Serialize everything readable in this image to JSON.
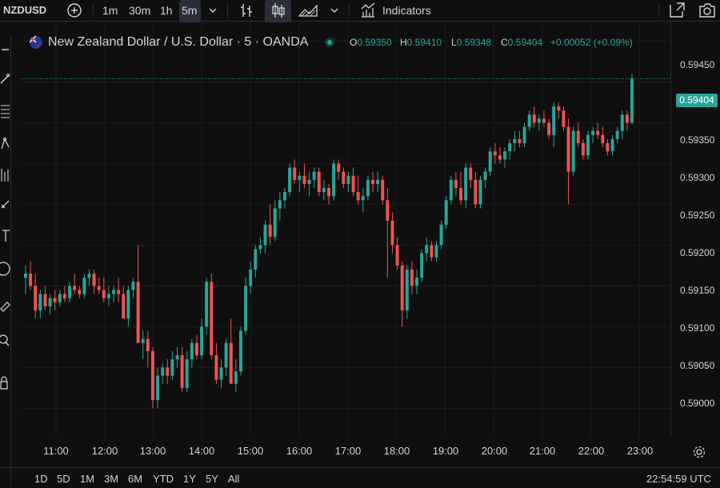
{
  "toolbar": {
    "symbol": "NZDUSD",
    "intervals": [
      "1m",
      "30m",
      "1h",
      "5m"
    ],
    "active_interval": "5m",
    "indicators_label": "Indicators"
  },
  "legend": {
    "title": "New Zealand Dollar / U.S. Dollar · 5 · OANDA",
    "o_key": "O",
    "o_val": "0.59350",
    "h_key": "H",
    "h_val": "0.59410",
    "l_key": "L",
    "l_val": "0.59348",
    "c_key": "C",
    "c_val": "0.59404",
    "change": "+0.00052 (+0.09%)"
  },
  "current_price": "0.59404",
  "colors": {
    "up": "#26a69a",
    "down": "#ef5350",
    "background": "#0f0f0f",
    "grid": "#1c1c1c"
  },
  "bottom": {
    "ranges": [
      "1D",
      "5D",
      "1M",
      "3M",
      "6M",
      "YTD",
      "1Y",
      "5Y",
      "All"
    ],
    "clock": "22:54:59 UTC"
  },
  "chart_data": {
    "type": "candlestick",
    "title": "New Zealand Dollar / U.S. Dollar · 5 · OANDA",
    "y_ticks": [
      "0.59450",
      "0.59400",
      "0.59350",
      "0.59300",
      "0.59250",
      "0.59200",
      "0.59150",
      "0.59100",
      "0.59050",
      "0.59000"
    ],
    "x_ticks": [
      "11:00",
      "12:00",
      "13:00",
      "14:00",
      "15:00",
      "16:00",
      "17:00",
      "18:00",
      "19:00",
      "20:00",
      "21:00",
      "22:00",
      "23:00"
    ],
    "ylim": [
      0.58965,
      0.59475
    ],
    "candles": [
      [
        0.5916,
        0.59175,
        0.5914,
        0.59165
      ],
      [
        0.59165,
        0.5918,
        0.59145,
        0.5915
      ],
      [
        0.5915,
        0.59165,
        0.5911,
        0.5912
      ],
      [
        0.5912,
        0.59145,
        0.5911,
        0.5914
      ],
      [
        0.5914,
        0.5915,
        0.5912,
        0.59125
      ],
      [
        0.59125,
        0.5914,
        0.59115,
        0.59135
      ],
      [
        0.59135,
        0.59145,
        0.5912,
        0.5913
      ],
      [
        0.5913,
        0.59145,
        0.59125,
        0.5914
      ],
      [
        0.5914,
        0.5915,
        0.5913,
        0.59135
      ],
      [
        0.59135,
        0.59155,
        0.5913,
        0.5915
      ],
      [
        0.5915,
        0.59165,
        0.5914,
        0.59145
      ],
      [
        0.59145,
        0.5915,
        0.59135,
        0.5914
      ],
      [
        0.5914,
        0.59165,
        0.59135,
        0.5916
      ],
      [
        0.5916,
        0.5917,
        0.5915,
        0.59165
      ],
      [
        0.59165,
        0.5917,
        0.5914,
        0.5915
      ],
      [
        0.5915,
        0.5916,
        0.5914,
        0.59145
      ],
      [
        0.59145,
        0.5916,
        0.5913,
        0.59135
      ],
      [
        0.59135,
        0.5915,
        0.59125,
        0.5914
      ],
      [
        0.5914,
        0.5915,
        0.5913,
        0.59145
      ],
      [
        0.59145,
        0.5916,
        0.5913,
        0.5914
      ],
      [
        0.5914,
        0.5915,
        0.5911,
        0.5911
      ],
      [
        0.5911,
        0.5915,
        0.591,
        0.59145
      ],
      [
        0.59145,
        0.5916,
        0.59135,
        0.59155
      ],
      [
        0.59155,
        0.592,
        0.5908,
        0.5908
      ],
      [
        0.5908,
        0.59095,
        0.5906,
        0.59085
      ],
      [
        0.59085,
        0.59095,
        0.5905,
        0.5907
      ],
      [
        0.5907,
        0.59075,
        0.59,
        0.5901
      ],
      [
        0.5901,
        0.5905,
        0.59,
        0.5904
      ],
      [
        0.5904,
        0.59055,
        0.5903,
        0.5905
      ],
      [
        0.5905,
        0.5906,
        0.5903,
        0.5904
      ],
      [
        0.5904,
        0.5907,
        0.59035,
        0.5906
      ],
      [
        0.5906,
        0.59075,
        0.5905,
        0.59065
      ],
      [
        0.59065,
        0.59075,
        0.5902,
        0.59025
      ],
      [
        0.59025,
        0.5907,
        0.5902,
        0.5906
      ],
      [
        0.5906,
        0.59085,
        0.5905,
        0.5908
      ],
      [
        0.5908,
        0.5909,
        0.5906,
        0.59065
      ],
      [
        0.59065,
        0.5911,
        0.5906,
        0.591
      ],
      [
        0.591,
        0.5916,
        0.5909,
        0.59155
      ],
      [
        0.59155,
        0.59165,
        0.5906,
        0.59065
      ],
      [
        0.59065,
        0.5908,
        0.5903,
        0.59035
      ],
      [
        0.59035,
        0.5906,
        0.59025,
        0.5905
      ],
      [
        0.5905,
        0.59085,
        0.5904,
        0.5908
      ],
      [
        0.5908,
        0.5911,
        0.5903,
        0.5903
      ],
      [
        0.5903,
        0.5906,
        0.5902,
        0.59045
      ],
      [
        0.59045,
        0.591,
        0.5904,
        0.59095
      ],
      [
        0.59095,
        0.5916,
        0.5909,
        0.5915
      ],
      [
        0.5915,
        0.5918,
        0.5914,
        0.5917
      ],
      [
        0.5917,
        0.592,
        0.5916,
        0.59195
      ],
      [
        0.59195,
        0.5921,
        0.5919,
        0.592
      ],
      [
        0.592,
        0.5923,
        0.5919,
        0.59225
      ],
      [
        0.59225,
        0.5925,
        0.592,
        0.5921
      ],
      [
        0.5921,
        0.59255,
        0.59205,
        0.59245
      ],
      [
        0.59245,
        0.59265,
        0.5923,
        0.59255
      ],
      [
        0.59255,
        0.5927,
        0.59245,
        0.59265
      ],
      [
        0.59265,
        0.593,
        0.5926,
        0.59295
      ],
      [
        0.59295,
        0.59305,
        0.59275,
        0.5928
      ],
      [
        0.5928,
        0.5929,
        0.59265,
        0.59285
      ],
      [
        0.59285,
        0.593,
        0.5927,
        0.59275
      ],
      [
        0.59275,
        0.5929,
        0.5926,
        0.5928
      ],
      [
        0.5928,
        0.59295,
        0.5927,
        0.5929
      ],
      [
        0.5929,
        0.59295,
        0.5926,
        0.59265
      ],
      [
        0.59265,
        0.5928,
        0.59255,
        0.5927
      ],
      [
        0.5927,
        0.59275,
        0.5925,
        0.5926
      ],
      [
        0.5926,
        0.59305,
        0.59255,
        0.593
      ],
      [
        0.593,
        0.59305,
        0.5928,
        0.5929
      ],
      [
        0.5929,
        0.59295,
        0.5927,
        0.59275
      ],
      [
        0.59275,
        0.5929,
        0.59265,
        0.59285
      ],
      [
        0.59285,
        0.59295,
        0.5926,
        0.59265
      ],
      [
        0.59265,
        0.59285,
        0.5925,
        0.59255
      ],
      [
        0.59255,
        0.5927,
        0.5924,
        0.5926
      ],
      [
        0.5926,
        0.59285,
        0.59255,
        0.5928
      ],
      [
        0.5928,
        0.5929,
        0.59265,
        0.59275
      ],
      [
        0.59275,
        0.5929,
        0.59265,
        0.5928
      ],
      [
        0.5928,
        0.59285,
        0.5925,
        0.59255
      ],
      [
        0.59255,
        0.5927,
        0.5916,
        0.5923
      ],
      [
        0.5923,
        0.5924,
        0.5919,
        0.592
      ],
      [
        0.592,
        0.5921,
        0.5917,
        0.59175
      ],
      [
        0.59175,
        0.5918,
        0.591,
        0.5912
      ],
      [
        0.5912,
        0.59175,
        0.5911,
        0.5917
      ],
      [
        0.5917,
        0.5918,
        0.5914,
        0.5915
      ],
      [
        0.5915,
        0.5917,
        0.5914,
        0.5916
      ],
      [
        0.5916,
        0.59195,
        0.59155,
        0.5919
      ],
      [
        0.5919,
        0.5921,
        0.5918,
        0.592
      ],
      [
        0.592,
        0.59205,
        0.5918,
        0.59185
      ],
      [
        0.59185,
        0.59205,
        0.5918,
        0.592
      ],
      [
        0.592,
        0.5923,
        0.59195,
        0.59225
      ],
      [
        0.59225,
        0.5926,
        0.5922,
        0.59255
      ],
      [
        0.59255,
        0.59285,
        0.5925,
        0.5928
      ],
      [
        0.5928,
        0.5929,
        0.5926,
        0.5927
      ],
      [
        0.5927,
        0.5929,
        0.5925,
        0.59255
      ],
      [
        0.59255,
        0.593,
        0.59245,
        0.59295
      ],
      [
        0.59295,
        0.593,
        0.5927,
        0.5928
      ],
      [
        0.5928,
        0.5929,
        0.59245,
        0.5925
      ],
      [
        0.5925,
        0.59285,
        0.59245,
        0.5928
      ],
      [
        0.5928,
        0.59295,
        0.5927,
        0.5929
      ],
      [
        0.5929,
        0.5932,
        0.59285,
        0.59315
      ],
      [
        0.59315,
        0.59325,
        0.593,
        0.5931
      ],
      [
        0.5931,
        0.5932,
        0.593,
        0.59305
      ],
      [
        0.59305,
        0.5932,
        0.59295,
        0.59315
      ],
      [
        0.59315,
        0.5933,
        0.59305,
        0.59325
      ],
      [
        0.59325,
        0.5934,
        0.59315,
        0.5933
      ],
      [
        0.5933,
        0.5934,
        0.5932,
        0.59325
      ],
      [
        0.59325,
        0.5935,
        0.5932,
        0.59345
      ],
      [
        0.59345,
        0.59365,
        0.5934,
        0.5936
      ],
      [
        0.5936,
        0.5937,
        0.59345,
        0.5935
      ],
      [
        0.5935,
        0.5936,
        0.5934,
        0.59355
      ],
      [
        0.59355,
        0.59365,
        0.59345,
        0.5935
      ],
      [
        0.5935,
        0.59355,
        0.5933,
        0.59335
      ],
      [
        0.59335,
        0.59375,
        0.5932,
        0.5937
      ],
      [
        0.5937,
        0.59375,
        0.59355,
        0.59365
      ],
      [
        0.59365,
        0.5937,
        0.5934,
        0.59345
      ],
      [
        0.59345,
        0.59355,
        0.5925,
        0.5929
      ],
      [
        0.5929,
        0.59345,
        0.59285,
        0.5934
      ],
      [
        0.5934,
        0.5935,
        0.5932,
        0.59325
      ],
      [
        0.59325,
        0.5933,
        0.59305,
        0.5931
      ],
      [
        0.5931,
        0.5934,
        0.59305,
        0.59335
      ],
      [
        0.59335,
        0.59345,
        0.59325,
        0.5934
      ],
      [
        0.5934,
        0.5935,
        0.5933,
        0.59335
      ],
      [
        0.59335,
        0.59345,
        0.5932,
        0.59325
      ],
      [
        0.59325,
        0.5933,
        0.5931,
        0.59315
      ],
      [
        0.59315,
        0.59335,
        0.5931,
        0.5933
      ],
      [
        0.5933,
        0.59345,
        0.59325,
        0.5934
      ],
      [
        0.5934,
        0.59365,
        0.5933,
        0.5936
      ],
      [
        0.5936,
        0.59365,
        0.5934,
        0.5935
      ],
      [
        0.5935,
        0.5941,
        0.59348,
        0.59404
      ]
    ]
  }
}
